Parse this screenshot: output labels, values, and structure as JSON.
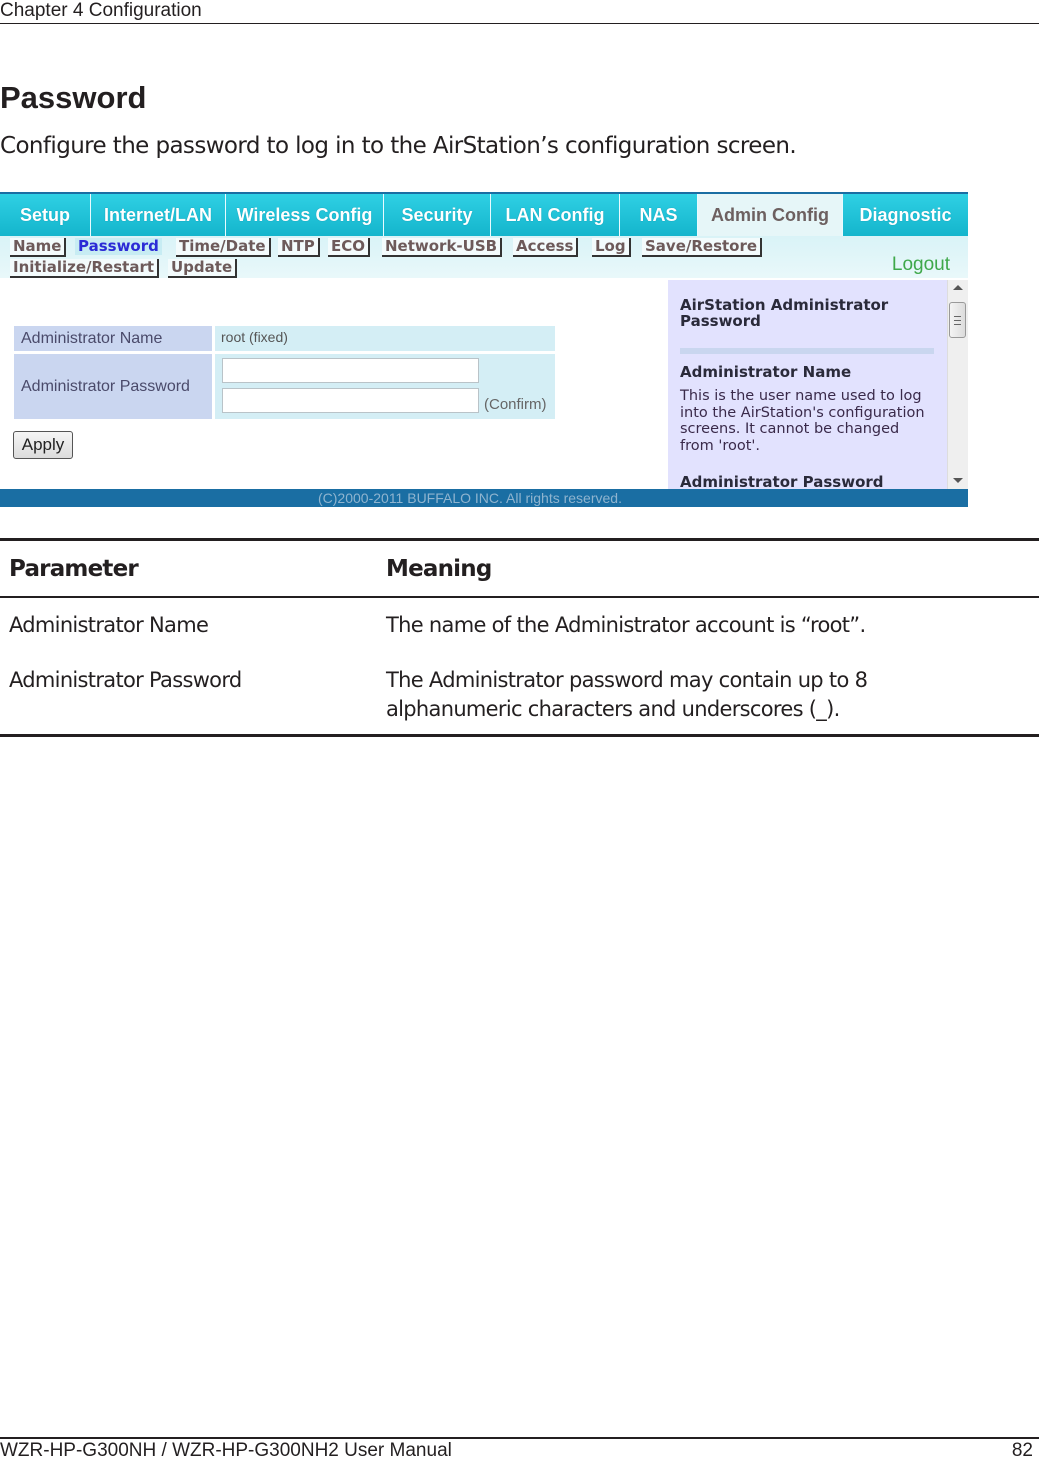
{
  "header": {
    "chapter": "Chapter 4  Configuration"
  },
  "section": {
    "title": "Password",
    "intro": "Configure the password to log in to the AirStation’s configuration screen."
  },
  "screenshot": {
    "tabs": [
      {
        "label": "Setup",
        "active": false
      },
      {
        "label": "Internet/LAN",
        "active": false
      },
      {
        "label": "Wireless Config",
        "active": false
      },
      {
        "label": "Security",
        "active": false
      },
      {
        "label": "LAN Config",
        "active": false
      },
      {
        "label": "NAS",
        "active": false
      },
      {
        "label": "Admin Config",
        "active": true
      },
      {
        "label": "Diagnostic",
        "active": false
      }
    ],
    "subnav": [
      {
        "label": "Name",
        "active": false
      },
      {
        "label": "Password",
        "active": true
      },
      {
        "label": "Time/Date",
        "active": false
      },
      {
        "label": "NTP",
        "active": false
      },
      {
        "label": "ECO",
        "active": false
      },
      {
        "label": "Network-USB",
        "active": false
      },
      {
        "label": "Access",
        "active": false
      },
      {
        "label": "Log",
        "active": false
      },
      {
        "label": "Save/Restore",
        "active": false
      },
      {
        "label": "Initialize/Restart",
        "active": false
      },
      {
        "label": "Update",
        "active": false
      }
    ],
    "logout_label": "Logout",
    "form": {
      "admin_name_label": "Administrator Name",
      "admin_name_value": "root (fixed)",
      "admin_password_label": "Administrator Password",
      "password_value": "",
      "confirm_value": "",
      "confirm_label": "(Confirm)",
      "apply_label": "Apply"
    },
    "help": {
      "title": "AirStation Administrator Password",
      "name_heading": "Administrator Name",
      "name_text": "This is the user name used to log into the AirStation's configuration screens. It cannot be changed from 'root'.",
      "password_heading": "Administrator Password"
    },
    "copyright": "(C)2000-2011 BUFFALO INC. All rights reserved.",
    "colors": {
      "tab_bar": "#1ec3d8",
      "footer_bar": "#1a6ea3",
      "help_bg": "#e2e2fe",
      "active_sublink": "#2b2bd6",
      "logout": "#3fa84a"
    }
  },
  "param_table": {
    "headers": [
      "Parameter",
      "Meaning"
    ],
    "rows": [
      {
        "parameter": "Administrator Name",
        "meaning": "The name of the Administrator account is “root”."
      },
      {
        "parameter": "Administrator Password",
        "meaning": "The Administrator password may contain up to 8 alphanumeric characters and underscores (_)."
      }
    ]
  },
  "footer": {
    "manual": "WZR-HP-G300NH / WZR-HP-G300NH2 User Manual",
    "page": "82"
  }
}
